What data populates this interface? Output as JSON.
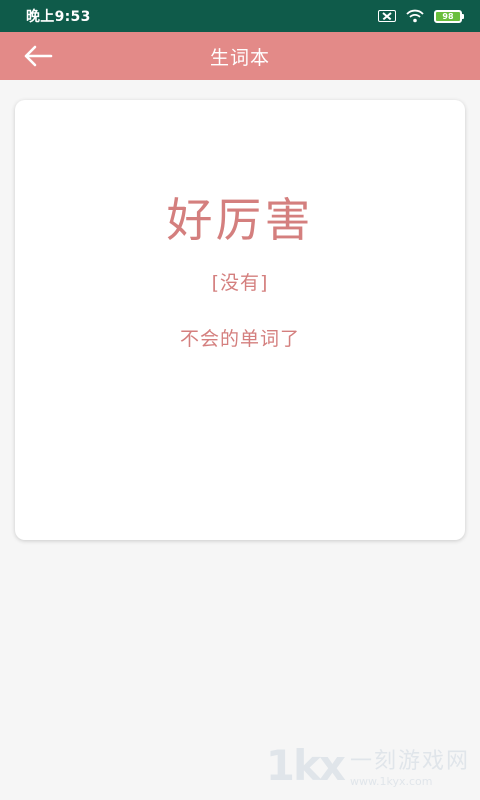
{
  "status_bar": {
    "time": "晚上9:53",
    "battery": "98",
    "icons": [
      "sim-blocked-icon",
      "wifi-icon",
      "battery-icon"
    ]
  },
  "app_bar": {
    "title": "生词本",
    "back_icon": "arrow-left-icon"
  },
  "card": {
    "word": "好厉害",
    "phonetic": "[没有]",
    "meaning": "不会的单词了"
  },
  "watermark": {
    "logo": "1kx",
    "name": "一刻游戏网",
    "url": "www.1kyx.com"
  },
  "colors": {
    "status_bar": "#0f5b4a",
    "app_bar": "#e38a88",
    "accent_text": "#d47f7e",
    "background": "#f6f6f6",
    "card": "#ffffff",
    "battery_fill": "#6abf3c"
  }
}
